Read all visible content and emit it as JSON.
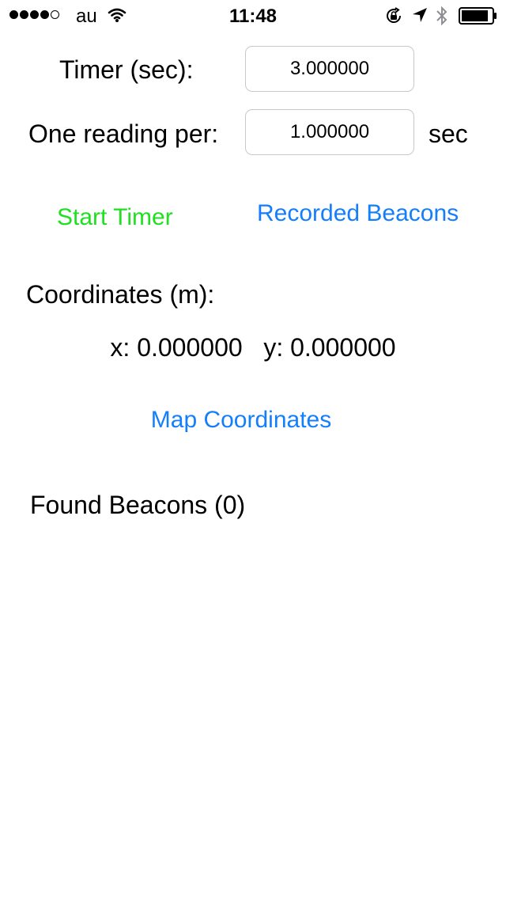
{
  "status_bar": {
    "carrier": "au",
    "time": "11:48",
    "signal_bars_filled": 4,
    "signal_bars_total": 5,
    "icons": [
      "wifi-icon",
      "rotation-lock-icon",
      "location-arrow-icon",
      "bluetooth-icon",
      "battery-icon"
    ]
  },
  "timer": {
    "label": "Timer (sec):",
    "value": "3.000000"
  },
  "reading": {
    "label": "One reading per:",
    "value": "1.000000",
    "unit": "sec"
  },
  "actions": {
    "start_timer": "Start Timer",
    "recorded_beacons": "Recorded Beacons",
    "map_coordinates": "Map Coordinates"
  },
  "coordinates": {
    "label": "Coordinates (m):",
    "x_label": "x:",
    "x_value": "0.000000",
    "y_label": "y:",
    "y_value": "0.000000"
  },
  "found_beacons": {
    "label": "Found Beacons (0)"
  },
  "colors": {
    "start_timer": "#1fe01f",
    "link_blue": "#147efb",
    "field_border": "#c8c8cc"
  }
}
